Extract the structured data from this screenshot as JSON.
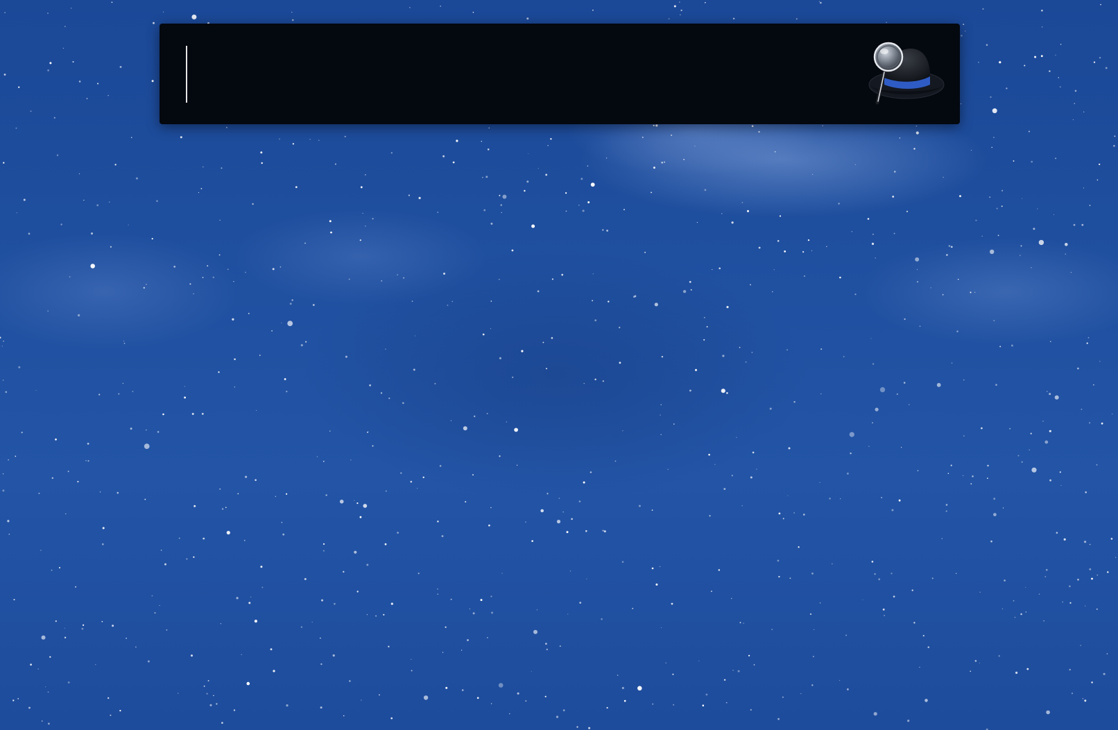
{
  "launcher": {
    "query_value": "",
    "query_placeholder": "",
    "icon": "alfred-hat-magnifier-icon"
  },
  "desktop": {
    "wallpaper": "starry-night-sky"
  },
  "colors": {
    "bar_background": "#04080f",
    "sky_blue": "#2354a6",
    "caret": "#e6e6e6",
    "hat_band": "#2f5cc4"
  }
}
